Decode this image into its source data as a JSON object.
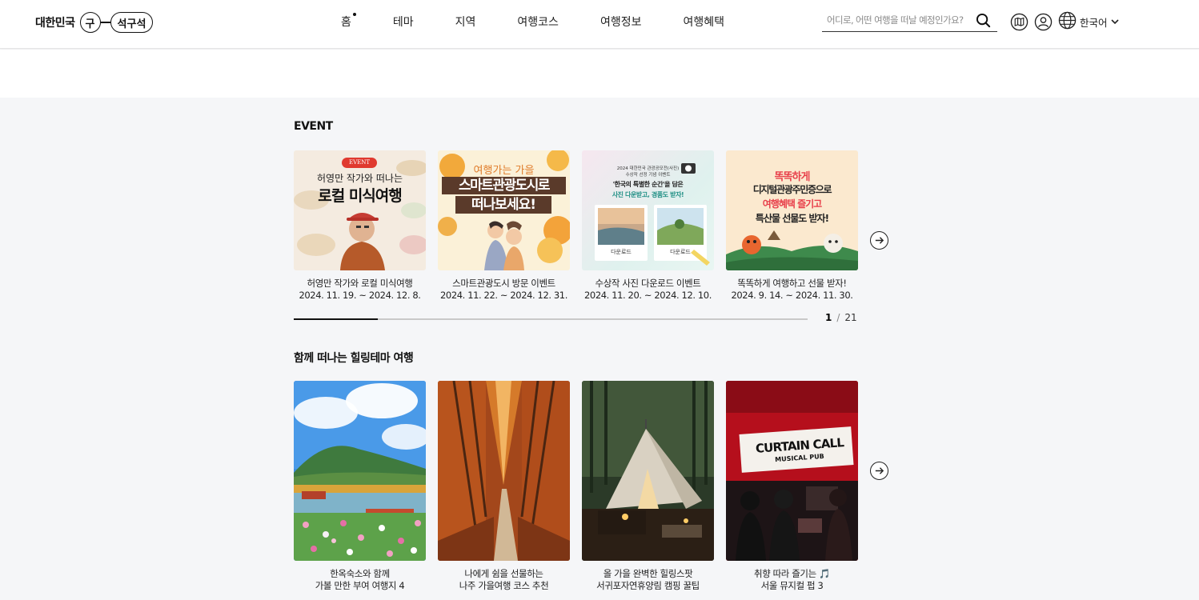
{
  "header": {
    "logo": {
      "text": "대한민국",
      "mark_circle": "구",
      "mark_pill": "석구석"
    },
    "nav": [
      {
        "label": "홈",
        "active": true
      },
      {
        "label": "테마",
        "active": false
      },
      {
        "label": "지역",
        "active": false
      },
      {
        "label": "여행코스",
        "active": false
      },
      {
        "label": "여행정보",
        "active": false
      },
      {
        "label": "여행혜택",
        "active": false
      }
    ],
    "search": {
      "placeholder": "어디로, 어떤 여행을 떠날 예정인가요?"
    },
    "icons": [
      "search-icon",
      "map-icon",
      "user-icon",
      "globe-icon",
      "chevron-down-icon"
    ],
    "language": "한국어"
  },
  "events": {
    "title": "EVENT",
    "cards": [
      {
        "art_badge": "EVENT",
        "art_line1": "허영만 작가와 떠나는",
        "art_line2": "로컬 미식여행",
        "title": "허영만 작가와 로컬 미식여행",
        "date": "2024. 11. 19. ~ 2024. 12. 8."
      },
      {
        "art_line1": "여행가는 가을",
        "art_line2": "스마트관광도시로",
        "art_line3": "떠나보세요!",
        "title": "스마트관광도시 방문 이벤트",
        "date": "2024. 11. 22. ~ 2024. 12. 31."
      },
      {
        "art_line1": "2024 대한민국 관광공모전(사진)",
        "art_line2": "수상작 선정 기념 이벤트",
        "art_line3": "'한국의 특별한 순간'을 담은",
        "art_line4": "사진 다운받고, 경품도 받자!",
        "art_btn": "다운로드",
        "title": "수상작 사진 다운로드 이벤트",
        "date": "2024. 11. 20. ~ 2024. 12. 10."
      },
      {
        "art_line1": "똑똑하게",
        "art_line2": "디지털관광주민증으로",
        "art_line3": "여행혜택 즐기고",
        "art_line4": "특산물 선물도 받자!",
        "title": "똑똑하게 여행하고 선물 받자!",
        "date": "2024. 9. 14. ~ 2024. 11. 30."
      }
    ],
    "pager": {
      "current": "1",
      "total": "21",
      "progress": 0.164
    }
  },
  "healing": {
    "title": "함께 떠나는 힐링테마 여행",
    "cards": [
      {
        "line1": "한옥숙소와 함께",
        "line2": "가볼 만한 부여 여행지 4"
      },
      {
        "line1": "나에게 쉼을 선물하는",
        "line2": "나주 가을여행 코스 추천"
      },
      {
        "line1": "올 가을 완벽한 힐링스팟",
        "line2": "서귀포자연휴양림 캠핑 꿀팁"
      },
      {
        "line1": "취향 따라 즐기는 🎵",
        "line2": "서울 뮤지컬 펍 3",
        "art_sign1": "CURTAIN CALL",
        "art_sign2": "MUSICAL PUB"
      }
    ]
  },
  "colors": {
    "accent": "#111111",
    "bg": "#f5f6f8",
    "event_badge": "#e03a2f"
  }
}
